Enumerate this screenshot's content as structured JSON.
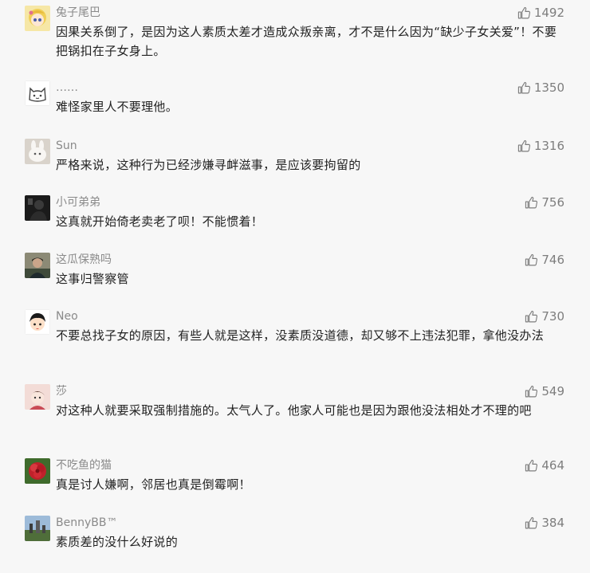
{
  "comments": [
    {
      "username": "兔子尾巴",
      "text": "因果关系倒了，是因为这人素质太差才造成众叛亲离，才不是什么因为“缺少子女关爱”！不要把锅扣在子女身上。",
      "likes": "1492",
      "avatar_icon": "cartoon-girl-avatar-icon",
      "avatar_color": "#f3d774"
    },
    {
      "username": "……",
      "text": "难怪家里人不要理他。",
      "likes": "1350",
      "avatar_icon": "cat-doodle-avatar-icon",
      "avatar_color": "#ffffff"
    },
    {
      "username": "Sun",
      "text": "严格来说，这种行为已经涉嫌寻衅滋事，是应该要拘留的",
      "likes": "1316",
      "avatar_icon": "white-rabbit-avatar-icon",
      "avatar_color": "#e9e4de"
    },
    {
      "username": "小可弟弟",
      "text": "这真就开始倚老卖老了呗！不能惯着！",
      "likes": "756",
      "avatar_icon": "dark-figure-avatar-icon",
      "avatar_color": "#1e1e1e"
    },
    {
      "username": "这瓜保熟吗",
      "text": "这事归警察管",
      "likes": "746",
      "avatar_icon": "person-photo-avatar-icon",
      "avatar_color": "#6d6a5a"
    },
    {
      "username": "Neo",
      "text": "不要总找子女的原因，有些人就是这样，没素质没道德，却又够不上违法犯罪，拿他没办法",
      "likes": "730",
      "avatar_icon": "cartoon-boy-avatar-icon",
      "avatar_color": "#ffffff"
    },
    {
      "username": "莎",
      "text": "对这种人就要采取强制措施的。太气人了。他家人可能也是因为跟他没法相处才不理的吧",
      "likes": "549",
      "avatar_icon": "cartoon-face-avatar-icon",
      "avatar_color": "#f1d6d2"
    },
    {
      "username": "不吃鱼的猫",
      "text": "真是讨人嫌啊，邻居也真是倒霉啊！",
      "likes": "464",
      "avatar_icon": "red-flower-avatar-icon",
      "avatar_color": "#c0212b"
    },
    {
      "username": "BennyBB™",
      "text": "素质差的没什么好说的",
      "likes": "384",
      "avatar_icon": "landscape-avatar-icon",
      "avatar_color": "#7ca0c4"
    }
  ],
  "colors": {
    "background": "#f7f7f7",
    "username": "#8a8a8a",
    "text": "#222222",
    "like": "#7d7d7d"
  }
}
